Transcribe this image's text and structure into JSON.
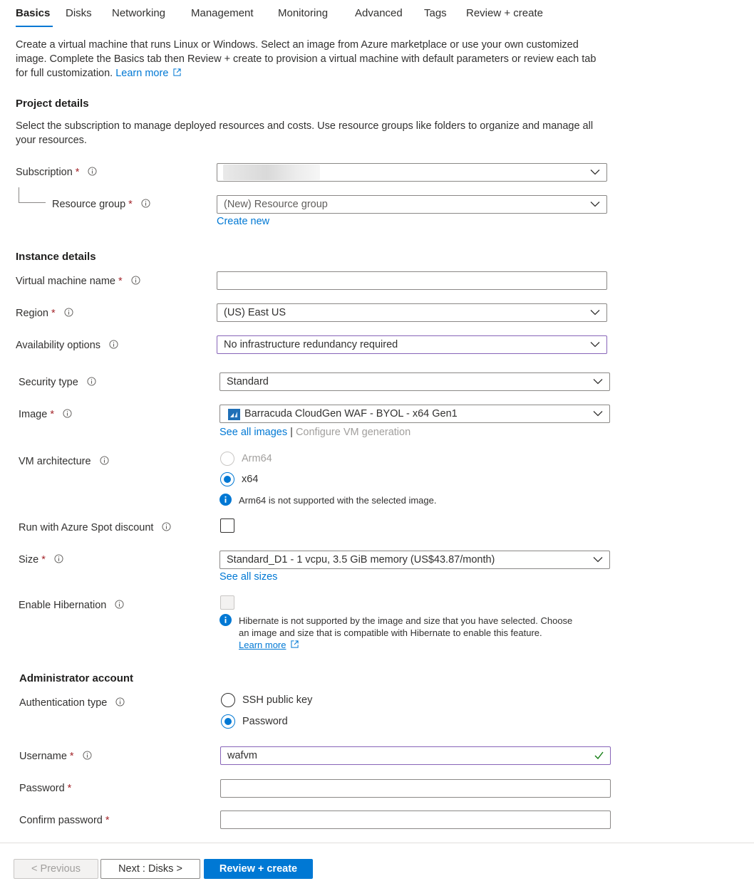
{
  "tabs": [
    {
      "label": "Basics",
      "active": true
    },
    {
      "label": "Disks"
    },
    {
      "label": "Networking"
    },
    {
      "label": "Management"
    },
    {
      "label": "Monitoring"
    },
    {
      "label": "Advanced"
    },
    {
      "label": "Tags"
    },
    {
      "label": "Review + create"
    }
  ],
  "intro": {
    "line1": "Create a virtual machine that runs Linux or Windows. Select an image from Azure marketplace or use your own customized",
    "line2": "image. Complete the Basics tab then Review + create to provision a virtual machine with default parameters or review each tab",
    "line3": "for full customization.",
    "learn_more": "Learn more"
  },
  "project": {
    "title": "Project details",
    "desc_line1": "Select the subscription to manage deployed resources and costs. Use resource groups like folders to organize and manage all",
    "desc_line2": "your resources.",
    "subscription_label": "Subscription",
    "resource_group_label": "Resource group",
    "resource_group_value": "(New) Resource group",
    "create_new": "Create new"
  },
  "instance": {
    "title": "Instance details",
    "vm_name_label": "Virtual machine name",
    "vm_name_value": "",
    "region_label": "Region",
    "region_value": "(US) East US",
    "availability_label": "Availability options",
    "availability_value": "No infrastructure redundancy required",
    "security_label": "Security type",
    "security_value": "Standard",
    "image_label": "Image",
    "image_value": "Barracuda CloudGen WAF - BYOL - x64 Gen1",
    "see_all_images": "See all images",
    "separator": "|",
    "configure_vm_generation": "Configure VM generation",
    "arch_label": "VM architecture",
    "arch_options": [
      "Arm64",
      "x64"
    ],
    "arch_selected": "x64",
    "arch_note": "Arm64 is not supported with the selected image.",
    "spot_label": "Run with Azure Spot discount",
    "size_label": "Size",
    "size_value": "Standard_D1 - 1 vcpu, 3.5 GiB memory (US$43.87/month)",
    "see_all_sizes": "See all sizes",
    "hibernation_label": "Enable Hibernation",
    "hibernation_note_line1": "Hibernate is not supported by the image and size that you have selected. Choose",
    "hibernation_note_line2": "an image and size that is compatible with Hibernate to enable this feature.",
    "hibernation_learn_more": "Learn more"
  },
  "admin": {
    "title": "Administrator account",
    "auth_label": "Authentication type",
    "auth_options": [
      "SSH public key",
      "Password"
    ],
    "auth_selected": "Password",
    "username_label": "Username",
    "username_value": "wafvm",
    "password_label": "Password",
    "confirm_password_label": "Confirm password"
  },
  "footer": {
    "previous": "< Previous",
    "next": "Next : Disks >",
    "review_create": "Review + create"
  },
  "required_mark": "*",
  "colors": {
    "accent": "#0078d4",
    "required": "#a4262c",
    "focus_border": "#8764b8",
    "valid_check": "#107c10"
  }
}
